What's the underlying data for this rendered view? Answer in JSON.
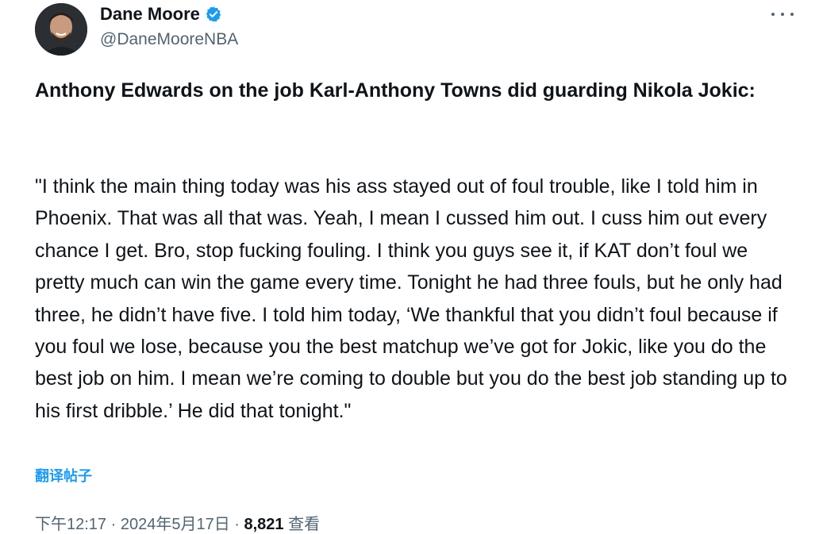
{
  "author": {
    "display_name": "Dane Moore",
    "handle": "@DaneMooreNBA",
    "verified_icon": "verified-badge-icon",
    "avatar_icon": "avatar-photo"
  },
  "post": {
    "headline": "Anthony Edwards on the job Karl-Anthony Towns did guarding Nikola Jokic:",
    "quote": "\"I think the main thing today was his ass stayed out of foul trouble, like I told him in Phoenix. That was all that was. Yeah, I mean I cussed him out. I cuss him out every chance I get. Bro, stop fucking fouling. I think you guys see it, if KAT don’t foul we pretty much can win the game every time. Tonight he had three fouls, but he only had three, he didn’t have five. I told him today, ‘We thankful that you didn’t foul because if you foul we lose, because you the best matchup we’ve got for Jokic, like you do the best job on him. I mean we’re coming to double but you do the best job standing up to his first dribble.’ He did that tonight.\"",
    "translate_label": "翻译帖子"
  },
  "meta": {
    "time": "下午12:17",
    "separator1": " · ",
    "date": "2024年5月17日",
    "separator2": " · ",
    "views_count": "8,821",
    "views_label": " 查看"
  },
  "colors": {
    "accent": "#1d9bf0",
    "text": "#0f1419",
    "secondary_text": "#536471"
  }
}
